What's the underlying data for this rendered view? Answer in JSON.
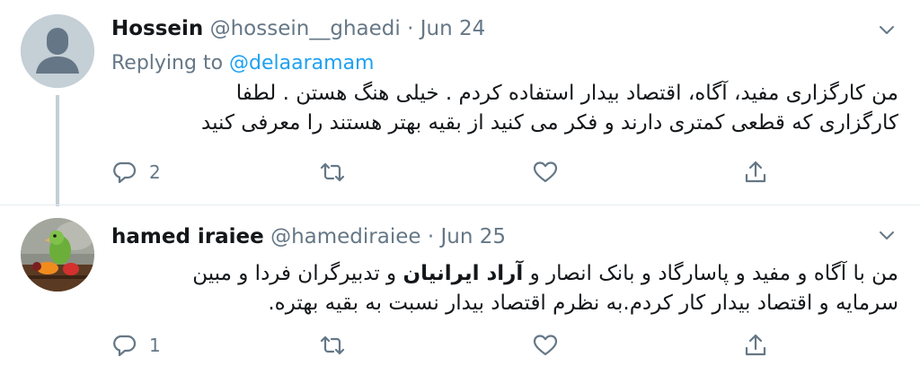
{
  "tweets": [
    {
      "name": "Hossein",
      "handle": "@hossein__ghaedi",
      "separator": "·",
      "date": "Jun 24",
      "replying_prefix": "Replying to",
      "replying_to": "@delaaramam",
      "text_line1": "من کارگزاری مفید، آگاه، اقتصاد بیدار استفاده کردم . خیلی هنگ هستن . لطفا",
      "text_line2": "کارگزاری که قطعی کمتری دارند و فکر می کنید از بقیه بهتر هستند را  معرفی کنید",
      "reply_count": "2",
      "avatar": "default-profile-avatar",
      "icons": [
        "reply-icon",
        "retweet-icon",
        "like-icon",
        "share-icon",
        "chevron-down-icon"
      ]
    },
    {
      "name": "hamed iraiee",
      "handle": "@hamediraiee",
      "separator": "·",
      "date": "Jun 25",
      "text_line1_part1": "من با آگاه و مفید و پاسارگاد و بانک انصار و ",
      "text_line1_bold": "آراد ایرانیان",
      "text_line1_part2": " و تدبیرگران فردا و مبین",
      "text_line2": "سرمایه و اقتصاد بیدار کار کردم.به نظرم اقتصاد بیدار نسبت به بقیه بهتره.",
      "reply_count": "1",
      "avatar": "parrot-photo-avatar",
      "icons": [
        "reply-icon",
        "retweet-icon",
        "like-icon",
        "share-icon",
        "chevron-down-icon"
      ]
    }
  ],
  "colors": {
    "text": "#14171a",
    "secondary": "#657786",
    "link": "#1da1f2",
    "thread_line": "#c4cfd6",
    "divider": "#e6ecf0"
  }
}
